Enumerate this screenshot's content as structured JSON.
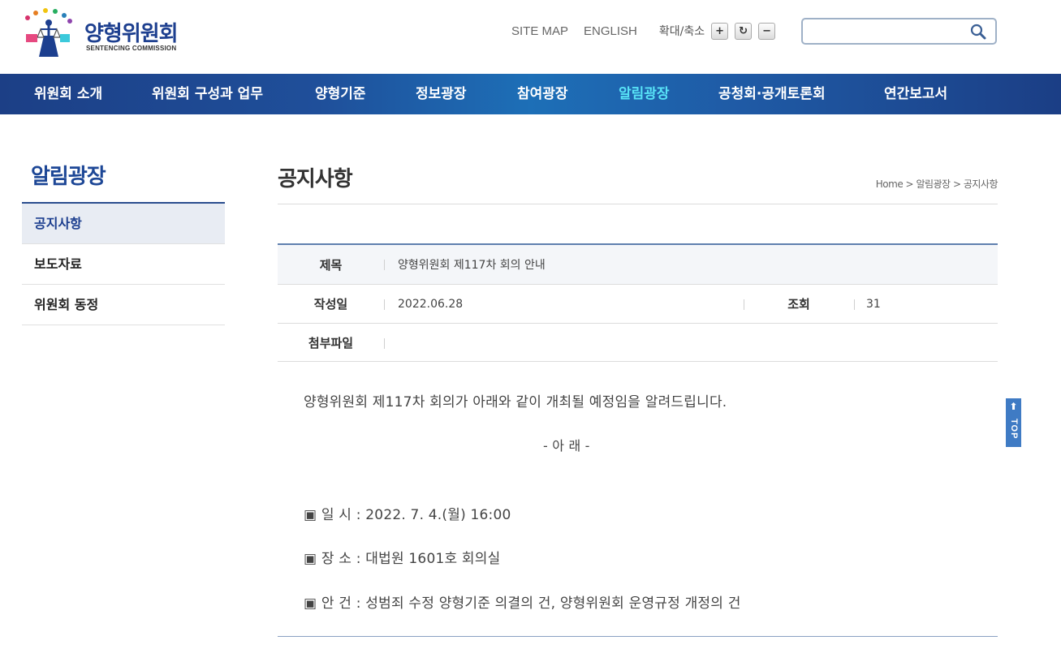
{
  "header": {
    "logo_title": "양형위원회",
    "logo_sub": "SENTENCING COMMISSION",
    "util_links": [
      "SITE MAP",
      "ENGLISH"
    ],
    "zoom_label": "확대/축소",
    "zoom_buttons": [
      "+",
      "↻",
      "−"
    ],
    "search_placeholder": "",
    "search_value": ""
  },
  "gnb": [
    {
      "label": "위원회 소개"
    },
    {
      "label": "위원회 구성과 업무"
    },
    {
      "label": "양형기준"
    },
    {
      "label": "정보광장"
    },
    {
      "label": "참여광장"
    },
    {
      "label": "알림광장",
      "active": true
    },
    {
      "label": "공청회·공개토론회"
    },
    {
      "label": "연간보고서"
    }
  ],
  "lnb": {
    "title": "알림광장",
    "items": [
      {
        "label": "공지사항",
        "active": true
      },
      {
        "label": "보도자료"
      },
      {
        "label": "위원회 동정"
      }
    ]
  },
  "content": {
    "title": "공지사항",
    "breadcrumb": [
      "Home",
      ">",
      "알림광장",
      ">",
      "공지사항"
    ],
    "view": {
      "subject_label": "제목",
      "subject_value": "양형위원회 제117차 회의 안내",
      "date_label": "작성일",
      "date_value": "2022.06.28",
      "views_label": "조회",
      "views_value": "31",
      "attach_label": "첨부파일",
      "attach_value": ""
    },
    "body": {
      "intro": "양형위원회 제117차 회의가 아래와 같이 개최될 예정임을 알려드립니다.",
      "center": "- 아 래 -",
      "line1": "▣ 일 시 : 2022. 7. 4.(월) 16:00",
      "line2": "▣ 장 소 : 대법원 1601호 회의실",
      "line3": "▣ 안 건 : 성범죄 수정 양형기준 의결의 건, 양형위원회 운영규정 개정의 건"
    }
  },
  "top_button": "TOP",
  "colors": {
    "brand_navy": "#1d3f8f",
    "gnb_active": "#58e3f7",
    "top_button": "#3f7bc4"
  }
}
